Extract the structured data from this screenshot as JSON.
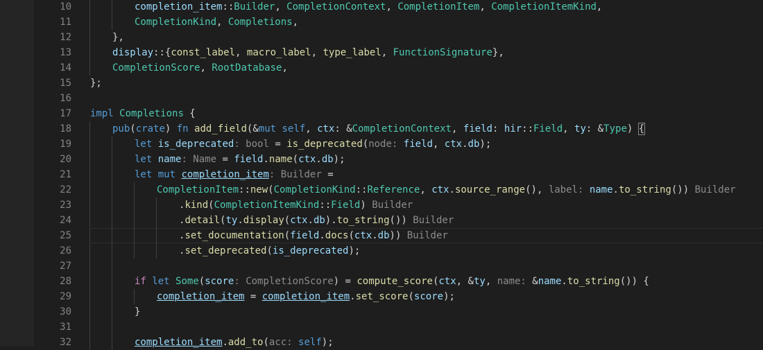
{
  "editor": {
    "colors": {
      "background": "#1e1e1e",
      "line_number": "#858585",
      "keyword": "#569cd6",
      "type": "#4ec9b0",
      "function": "#dcdcaa",
      "variable": "#9cdcfe",
      "control": "#c586c0",
      "inlay_hint": "#8c8c8c"
    },
    "current_line": 25,
    "lines": [
      {
        "n": "10",
        "indent": 2,
        "tokens": [
          [
            "completion_item",
            "var"
          ],
          [
            "::",
            "pun"
          ],
          [
            "Builder",
            "ty"
          ],
          [
            ", ",
            "pun"
          ],
          [
            "CompletionContext",
            "ty"
          ],
          [
            ", ",
            "pun"
          ],
          [
            "CompletionItem",
            "ty"
          ],
          [
            ", ",
            "pun"
          ],
          [
            "CompletionItemKind",
            "ty"
          ],
          [
            ",",
            "pun"
          ]
        ]
      },
      {
        "n": "11",
        "indent": 2,
        "tokens": [
          [
            "CompletionKind",
            "ty"
          ],
          [
            ", ",
            "pun"
          ],
          [
            "Completions",
            "ty"
          ],
          [
            ",",
            "pun"
          ]
        ]
      },
      {
        "n": "12",
        "indent": 1,
        "tokens": [
          [
            "},",
            "pun"
          ]
        ]
      },
      {
        "n": "13",
        "indent": 1,
        "tokens": [
          [
            "display",
            "var"
          ],
          [
            "::{",
            "pun"
          ],
          [
            "const_label",
            "fn"
          ],
          [
            ", ",
            "pun"
          ],
          [
            "macro_label",
            "fn"
          ],
          [
            ", ",
            "pun"
          ],
          [
            "type_label",
            "fn"
          ],
          [
            ", ",
            "pun"
          ],
          [
            "FunctionSignature",
            "ty"
          ],
          [
            "},",
            "pun"
          ]
        ]
      },
      {
        "n": "14",
        "indent": 1,
        "tokens": [
          [
            "CompletionScore",
            "ty"
          ],
          [
            ", ",
            "pun"
          ],
          [
            "RootDatabase",
            "ty"
          ],
          [
            ",",
            "pun"
          ]
        ]
      },
      {
        "n": "15",
        "indent": 0,
        "tokens": [
          [
            "};",
            "pun"
          ]
        ]
      },
      {
        "n": "16",
        "indent": 0,
        "tokens": []
      },
      {
        "n": "17",
        "indent": 0,
        "tokens": [
          [
            "impl",
            "kw"
          ],
          [
            " ",
            "pun"
          ],
          [
            "Completions",
            "ty"
          ],
          [
            " {",
            "pun"
          ]
        ]
      },
      {
        "n": "18",
        "indent": 1,
        "tokens": [
          [
            "pub",
            "kw"
          ],
          [
            "(",
            "pun"
          ],
          [
            "crate",
            "kw"
          ],
          [
            ") ",
            "pun"
          ],
          [
            "fn",
            "kw"
          ],
          [
            " ",
            "pun"
          ],
          [
            "add_field",
            "fn"
          ],
          [
            "(&",
            "pun"
          ],
          [
            "mut",
            "kw"
          ],
          [
            " ",
            "pun"
          ],
          [
            "self",
            "kw"
          ],
          [
            ", ",
            "pun"
          ],
          [
            "ctx",
            "var"
          ],
          [
            ": &",
            "pun"
          ],
          [
            "CompletionContext",
            "ty"
          ],
          [
            ", ",
            "pun"
          ],
          [
            "field",
            "var"
          ],
          [
            ": ",
            "pun"
          ],
          [
            "hir",
            "var"
          ],
          [
            "::",
            "pun"
          ],
          [
            "Field",
            "ty"
          ],
          [
            ", ",
            "pun"
          ],
          [
            "ty",
            "var"
          ],
          [
            ": &",
            "pun"
          ],
          [
            "Type",
            "ty"
          ],
          [
            ") ",
            "pun"
          ],
          [
            "{",
            "bracket"
          ]
        ]
      },
      {
        "n": "19",
        "indent": 2,
        "tokens": [
          [
            "let",
            "kw"
          ],
          [
            " ",
            "pun"
          ],
          [
            "is_deprecated",
            "var"
          ],
          [
            ": bool",
            "hint"
          ],
          [
            " = ",
            "pun"
          ],
          [
            "is_deprecated",
            "fn"
          ],
          [
            "(",
            "pun"
          ],
          [
            "node: ",
            "hint"
          ],
          [
            "field",
            "var"
          ],
          [
            ", ",
            "pun"
          ],
          [
            "ctx",
            "var"
          ],
          [
            ".",
            "pun"
          ],
          [
            "db",
            "var"
          ],
          [
            ");",
            "pun"
          ]
        ]
      },
      {
        "n": "20",
        "indent": 2,
        "tokens": [
          [
            "let",
            "kw"
          ],
          [
            " ",
            "pun"
          ],
          [
            "name",
            "var"
          ],
          [
            ": Name",
            "hint"
          ],
          [
            " = ",
            "pun"
          ],
          [
            "field",
            "var"
          ],
          [
            ".",
            "pun"
          ],
          [
            "name",
            "fn"
          ],
          [
            "(",
            "pun"
          ],
          [
            "ctx",
            "var"
          ],
          [
            ".",
            "pun"
          ],
          [
            "db",
            "var"
          ],
          [
            ");",
            "pun"
          ]
        ]
      },
      {
        "n": "21",
        "indent": 2,
        "tokens": [
          [
            "let",
            "kw"
          ],
          [
            " ",
            "pun"
          ],
          [
            "mut",
            "kw"
          ],
          [
            " ",
            "pun"
          ],
          [
            "completion_item",
            "mut"
          ],
          [
            ": Builder",
            "hint"
          ],
          [
            " =",
            "pun"
          ]
        ]
      },
      {
        "n": "22",
        "indent": 3,
        "tokens": [
          [
            "CompletionItem",
            "ty"
          ],
          [
            "::",
            "pun"
          ],
          [
            "new",
            "fn"
          ],
          [
            "(",
            "pun"
          ],
          [
            "CompletionKind",
            "ty"
          ],
          [
            "::",
            "pun"
          ],
          [
            "Reference",
            "ty"
          ],
          [
            ", ",
            "pun"
          ],
          [
            "ctx",
            "var"
          ],
          [
            ".",
            "pun"
          ],
          [
            "source_range",
            "fn"
          ],
          [
            "(), ",
            "pun"
          ],
          [
            "label: ",
            "hint"
          ],
          [
            "name",
            "var"
          ],
          [
            ".",
            "pun"
          ],
          [
            "to_string",
            "fn"
          ],
          [
            "())",
            "pun"
          ],
          [
            " Builder",
            "hint"
          ]
        ]
      },
      {
        "n": "23",
        "indent": 4,
        "tokens": [
          [
            ".",
            "pun"
          ],
          [
            "kind",
            "fn"
          ],
          [
            "(",
            "pun"
          ],
          [
            "CompletionItemKind",
            "ty"
          ],
          [
            "::",
            "pun"
          ],
          [
            "Field",
            "ty"
          ],
          [
            ")",
            "pun"
          ],
          [
            " Builder",
            "hint"
          ]
        ]
      },
      {
        "n": "24",
        "indent": 4,
        "tokens": [
          [
            ".",
            "pun"
          ],
          [
            "detail",
            "fn"
          ],
          [
            "(",
            "pun"
          ],
          [
            "ty",
            "var"
          ],
          [
            ".",
            "pun"
          ],
          [
            "display",
            "fn"
          ],
          [
            "(",
            "pun"
          ],
          [
            "ctx",
            "var"
          ],
          [
            ".",
            "pun"
          ],
          [
            "db",
            "var"
          ],
          [
            ").",
            "pun"
          ],
          [
            "to_string",
            "fn"
          ],
          [
            "())",
            "pun"
          ],
          [
            " Builder",
            "hint"
          ]
        ]
      },
      {
        "n": "25",
        "indent": 4,
        "tokens": [
          [
            ".",
            "pun"
          ],
          [
            "set_documentation",
            "fn"
          ],
          [
            "(",
            "pun"
          ],
          [
            "field",
            "var"
          ],
          [
            ".",
            "pun"
          ],
          [
            "docs",
            "fn"
          ],
          [
            "(",
            "pun"
          ],
          [
            "ctx",
            "var"
          ],
          [
            ".",
            "pun"
          ],
          [
            "db",
            "var"
          ],
          [
            "))",
            "pun"
          ],
          [
            " Builder",
            "hint"
          ]
        ]
      },
      {
        "n": "26",
        "indent": 4,
        "tokens": [
          [
            ".",
            "pun"
          ],
          [
            "set_deprecated",
            "fn"
          ],
          [
            "(",
            "pun"
          ],
          [
            "is_deprecated",
            "var"
          ],
          [
            ");",
            "pun"
          ]
        ]
      },
      {
        "n": "27",
        "indent": 2,
        "tokens": []
      },
      {
        "n": "28",
        "indent": 2,
        "tokens": [
          [
            "if",
            "ctl"
          ],
          [
            " ",
            "pun"
          ],
          [
            "let",
            "kw"
          ],
          [
            " ",
            "pun"
          ],
          [
            "Some",
            "ty"
          ],
          [
            "(",
            "pun"
          ],
          [
            "score",
            "var"
          ],
          [
            ": CompletionScore",
            "hint"
          ],
          [
            ") = ",
            "pun"
          ],
          [
            "compute_score",
            "fn"
          ],
          [
            "(",
            "pun"
          ],
          [
            "ctx",
            "var"
          ],
          [
            ", &",
            "pun"
          ],
          [
            "ty",
            "var"
          ],
          [
            ", ",
            "pun"
          ],
          [
            "name: ",
            "hint"
          ],
          [
            "&",
            "pun"
          ],
          [
            "name",
            "var"
          ],
          [
            ".",
            "pun"
          ],
          [
            "to_string",
            "fn"
          ],
          [
            "()) {",
            "pun"
          ]
        ]
      },
      {
        "n": "29",
        "indent": 3,
        "tokens": [
          [
            "completion_item",
            "mut"
          ],
          [
            " = ",
            "pun"
          ],
          [
            "completion_item",
            "mut"
          ],
          [
            ".",
            "pun"
          ],
          [
            "set_score",
            "fn"
          ],
          [
            "(",
            "pun"
          ],
          [
            "score",
            "var"
          ],
          [
            ");",
            "pun"
          ]
        ]
      },
      {
        "n": "30",
        "indent": 2,
        "tokens": [
          [
            "}",
            "pun"
          ]
        ]
      },
      {
        "n": "31",
        "indent": 2,
        "tokens": []
      },
      {
        "n": "32",
        "indent": 2,
        "tokens": [
          [
            "completion_item",
            "mut"
          ],
          [
            ".",
            "pun"
          ],
          [
            "add_to",
            "fn"
          ],
          [
            "(",
            "pun"
          ],
          [
            "acc: ",
            "hint"
          ],
          [
            "self",
            "kw"
          ],
          [
            ");",
            "pun"
          ]
        ]
      }
    ]
  }
}
